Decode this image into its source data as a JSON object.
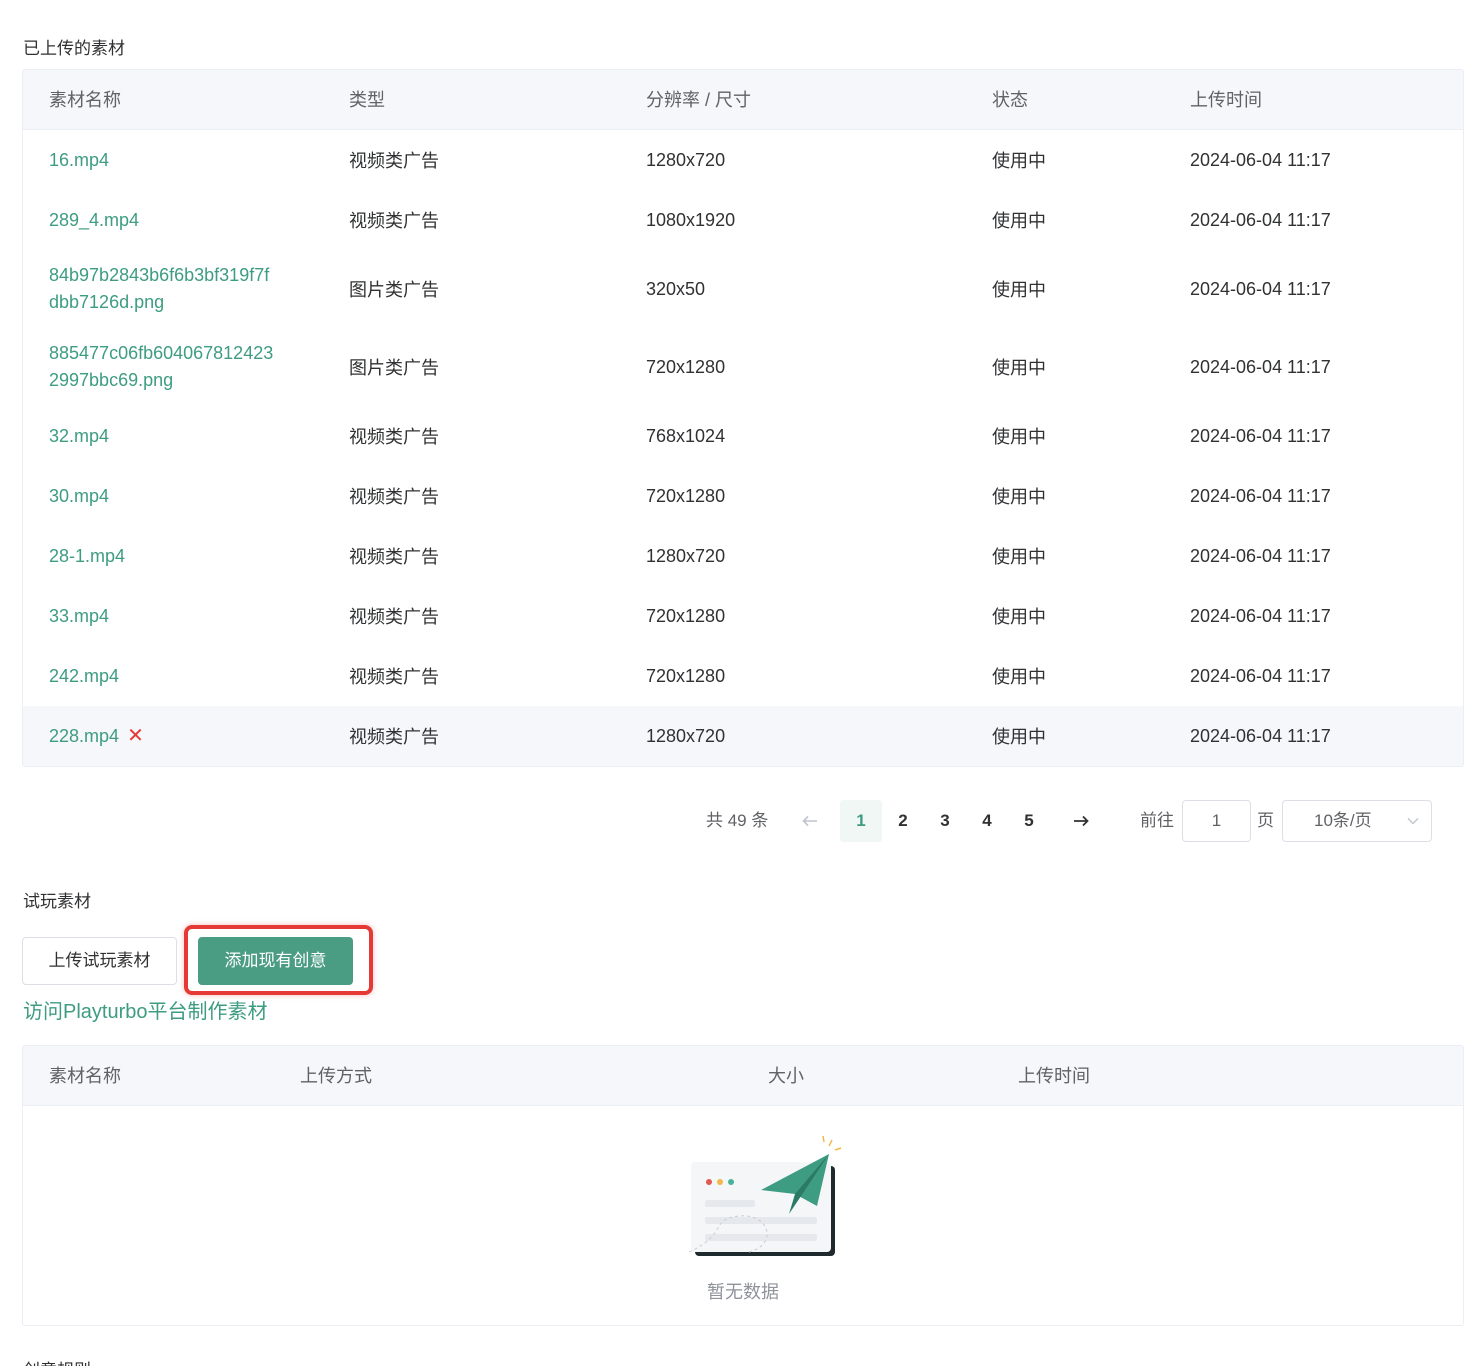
{
  "uploaded": {
    "title": "已上传的素材",
    "columns": [
      "素材名称",
      "类型",
      "分辨率 / 尺寸",
      "状态",
      "上传时间"
    ],
    "rows": [
      {
        "name": "16.mp4",
        "type": "视频类广告",
        "res": "1280x720",
        "status": "使用中",
        "time": "2024-06-04 11:17"
      },
      {
        "name": "289_4.mp4",
        "type": "视频类广告",
        "res": "1080x1920",
        "status": "使用中",
        "time": "2024-06-04 11:17"
      },
      {
        "name": "84b97b2843b6f6b3bf319f7fdbb7126d.png",
        "name_line1": "84b97b2843b6f6b3bf319f7f",
        "name_line2": "dbb7126d.png",
        "type": "图片类广告",
        "res": "320x50",
        "status": "使用中",
        "time": "2024-06-04 11:17"
      },
      {
        "name": "8854​77c06fb6040678124232997bbc69.png",
        "name_line1": "885477c06fb604067812423",
        "name_line2": "2997bbc69.png",
        "type": "图片类广告",
        "res": "720x1280",
        "status": "使用中",
        "time": "2024-06-04 11:17"
      },
      {
        "name": "32.mp4",
        "type": "视频类广告",
        "res": "768x1024",
        "status": "使用中",
        "time": "2024-06-04 11:17"
      },
      {
        "name": "30.mp4",
        "type": "视频类广告",
        "res": "720x1280",
        "status": "使用中",
        "time": "2024-06-04 11:17"
      },
      {
        "name": "28-1.mp4",
        "type": "视频类广告",
        "res": "1280x720",
        "status": "使用中",
        "time": "2024-06-04 11:17"
      },
      {
        "name": "33.mp4",
        "type": "视频类广告",
        "res": "720x1280",
        "status": "使用中",
        "time": "2024-06-04 11:17"
      },
      {
        "name": "242.mp4",
        "type": "视频类广告",
        "res": "720x1280",
        "status": "使用中",
        "time": "2024-06-04 11:17"
      },
      {
        "name": "228.mp4",
        "type": "视频类广告",
        "res": "1280x720",
        "status": "使用中",
        "time": "2024-06-04 11:17",
        "delete_mark": "✕"
      }
    ]
  },
  "pagination": {
    "total": "共 49 条",
    "pages": [
      "1",
      "2",
      "3",
      "4",
      "5"
    ],
    "active_page": "1",
    "goto_label": "前往",
    "goto_value": "1",
    "page_suffix": "页",
    "page_size": "10条/页"
  },
  "trial": {
    "title": "试玩素材",
    "upload_button": "上传试玩素材",
    "add_button": "添加现有创意",
    "link": "访问Playturbo平台制作素材",
    "columns": [
      "素材名称",
      "上传方式",
      "大小",
      "上传时间"
    ],
    "empty_text": "暂无数据"
  },
  "next_section": {
    "title": "创意规则"
  },
  "colors": {
    "accent": "#3d9c81",
    "primary_button": "#4a9c82",
    "highlight": "#e53935"
  }
}
